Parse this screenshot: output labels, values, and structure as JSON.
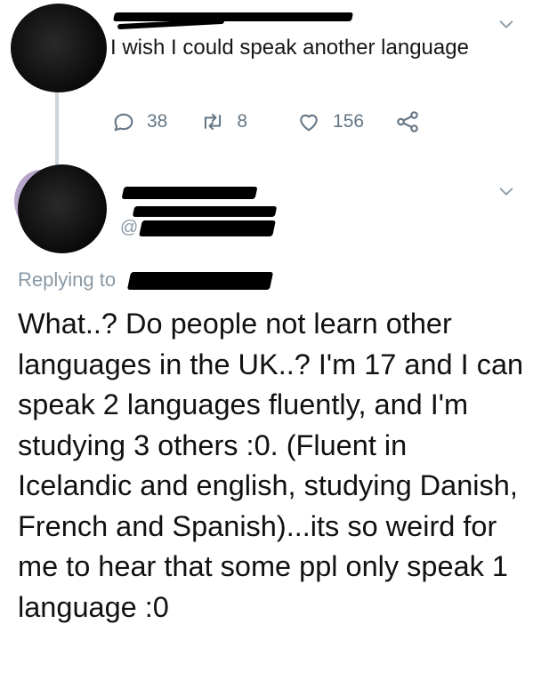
{
  "tweet1": {
    "text": "I wish I could speak another language",
    "stats": {
      "replies": "38",
      "retweets": "8",
      "likes": "156"
    }
  },
  "tweet2": {
    "handle_prefix": "@",
    "replying_label": "Replying to",
    "body": "What..? Do people not learn other languages in the UK..? I'm 17 and I can speak 2 languages fluently, and I'm studying 3 others :0. (Fluent in Icelandic and english, studying Danish, French and Spanish)...its so weird for me to hear that some ppl only speak 1 language :0"
  },
  "colors": {
    "secondary_text": "#657786",
    "body_text": "#14171a",
    "thread_line": "#cdd6dd"
  },
  "icons": [
    "reply-icon",
    "retweet-icon",
    "like-icon",
    "share-icon",
    "chevron-down-icon"
  ]
}
